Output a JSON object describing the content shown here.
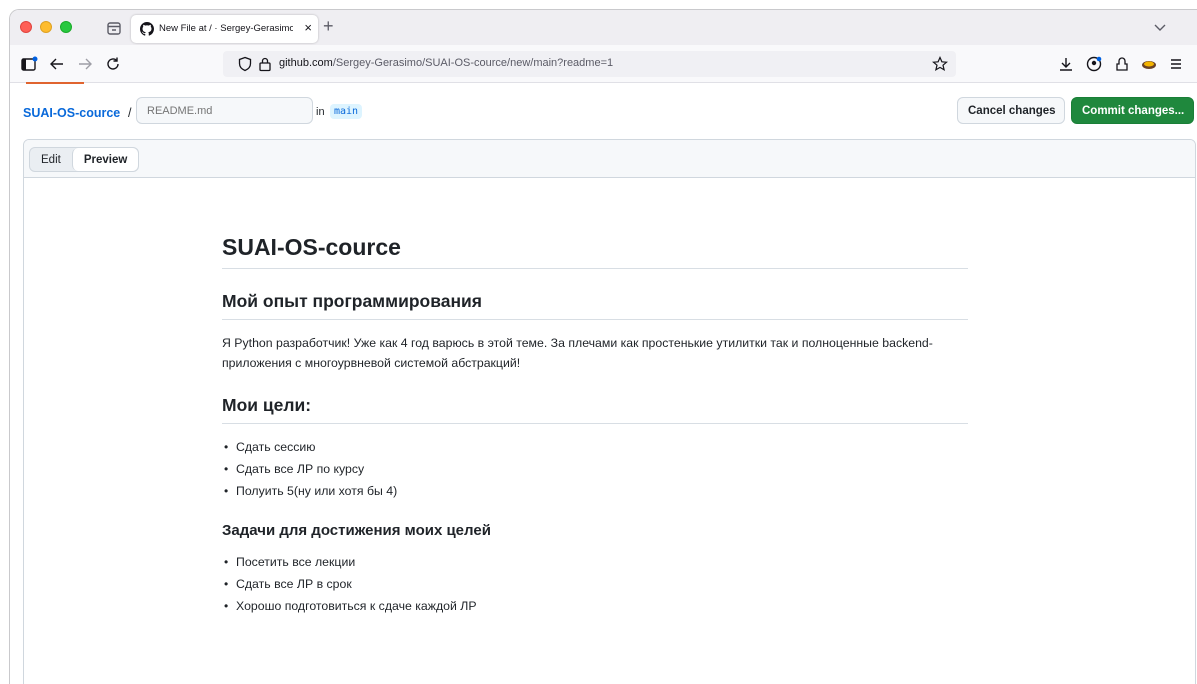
{
  "browser": {
    "tab_title": "New File at / · Sergey-Gerasimo",
    "tab_close": "×",
    "new_tab": "+",
    "url_host": "github.com",
    "url_path": "/Sergey-Gerasimo/SUAI-OS-cource/new/main?readme=1"
  },
  "header": {
    "repo": "SUAI-OS-cource",
    "separator": "/",
    "filename_placeholder": "README.md",
    "in_label": "in",
    "branch": "main",
    "cancel_label": "Cancel changes",
    "commit_label": "Commit changes..."
  },
  "editor": {
    "tabs": [
      {
        "label": "Edit",
        "active": false
      },
      {
        "label": "Preview",
        "active": true
      }
    ]
  },
  "preview": {
    "h1": "SUAI-OS-cource",
    "h2_experience": "Мой опыт программирования",
    "paragraph": "Я Python разработчик! Уже как 4 год варюсь в этой теме. За плечами как простенькие утилитки так и полноценные backend-приложения с многоурвневой системой абстракций!",
    "h2_goals": "Мои цели:",
    "goals": [
      "Сдать сессию",
      "Сдать все ЛР по курсу",
      "Полуить 5(ну или хотя бы 4)"
    ],
    "h3_tasks": "Задачи для достижения моих целей",
    "tasks": [
      "Посетить все лекции",
      "Сдать все ЛР в срок",
      "Хорошо подготовиться к сдаче каждой ЛР"
    ]
  },
  "colors": {
    "link": "#0969da",
    "commit_button": "#1f883d",
    "branch_bg": "#ddf4ff"
  },
  "icons": [
    "tab-overview-icon",
    "github-icon",
    "chevron-down-icon",
    "sidebar-icon",
    "back-icon",
    "forward-icon",
    "reload-icon",
    "shield-icon",
    "lock-icon",
    "bookmark-star-icon",
    "download-icon",
    "account-icon",
    "extensions-icon",
    "extension-icon",
    "menu-icon"
  ]
}
